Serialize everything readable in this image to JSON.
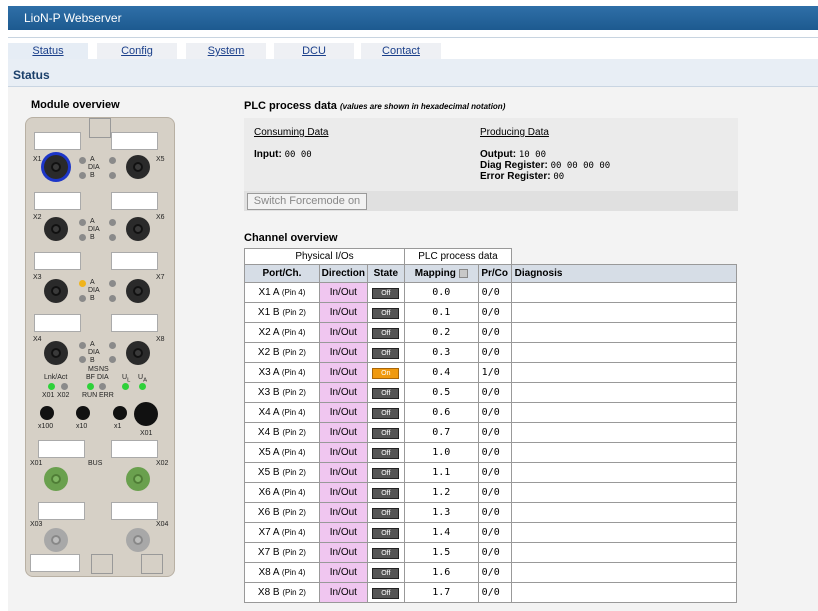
{
  "app": {
    "title": "LioN-P Webserver"
  },
  "tabs": [
    {
      "label": "Status",
      "active": true
    },
    {
      "label": "Config"
    },
    {
      "label": "System"
    },
    {
      "label": "DCU"
    },
    {
      "label": "Contact"
    }
  ],
  "status_label": "Status",
  "module": {
    "title": "Module overview",
    "ports": [
      "X1",
      "X5",
      "X2",
      "X6",
      "X3",
      "X7",
      "X4",
      "X8"
    ],
    "led_labels": {
      "a": "A",
      "dia": "DIA",
      "b": "B"
    },
    "status_labels": {
      "lnk_act": "Lnk/Act",
      "ms": "MS",
      "ns": "NS",
      "bf": "BF",
      "dia": "DIA",
      "ul": "U",
      "ul_sub": "L",
      "ua": "U",
      "ua_sub": "A",
      "x01": "X01",
      "x02": "X02",
      "run": "RUN",
      "err": "ERR"
    },
    "rotary_labels": [
      "x100",
      "x10",
      "x1"
    ],
    "x01_label": "X01",
    "bus_labels": {
      "left": "X01",
      "mid": "BUS",
      "right": "X02"
    },
    "power_labels": {
      "left": "X03",
      "right": "X04"
    }
  },
  "plc": {
    "title": "PLC process data",
    "note": "(values are shown in hexadecimal notation)",
    "consuming_label": "Consuming Data",
    "producing_label": "Producing Data",
    "input_label": "Input",
    "input_value": "00 00",
    "output_label": "Output",
    "output_value": "10 00",
    "diag_label": "Diag Register",
    "diag_value": "00 00 00 00",
    "error_label": "Error Register",
    "error_value": "00"
  },
  "force_button": "Switch Forcemode on",
  "channel": {
    "title": "Channel overview",
    "group_physical": "Physical I/Os",
    "group_plc": "PLC process data",
    "headers": {
      "port": "Port/Ch.",
      "direction": "Direction",
      "state": "State",
      "mapping": "Mapping",
      "prco": "Pr/Co",
      "diagnosis": "Diagnosis"
    },
    "rows": [
      {
        "port": "X1 A",
        "pin": "(Pin 4)",
        "direction": "In/Out",
        "state": "Off",
        "mapping": "0.0",
        "prco": "0/0"
      },
      {
        "port": "X1 B",
        "pin": "(Pin 2)",
        "direction": "In/Out",
        "state": "Off",
        "mapping": "0.1",
        "prco": "0/0"
      },
      {
        "port": "X2 A",
        "pin": "(Pin 4)",
        "direction": "In/Out",
        "state": "Off",
        "mapping": "0.2",
        "prco": "0/0"
      },
      {
        "port": "X2 B",
        "pin": "(Pin 2)",
        "direction": "In/Out",
        "state": "Off",
        "mapping": "0.3",
        "prco": "0/0"
      },
      {
        "port": "X3 A",
        "pin": "(Pin 4)",
        "direction": "In/Out",
        "state": "On",
        "mapping": "0.4",
        "prco": "1/0"
      },
      {
        "port": "X3 B",
        "pin": "(Pin 2)",
        "direction": "In/Out",
        "state": "Off",
        "mapping": "0.5",
        "prco": "0/0"
      },
      {
        "port": "X4 A",
        "pin": "(Pin 4)",
        "direction": "In/Out",
        "state": "Off",
        "mapping": "0.6",
        "prco": "0/0"
      },
      {
        "port": "X4 B",
        "pin": "(Pin 2)",
        "direction": "In/Out",
        "state": "Off",
        "mapping": "0.7",
        "prco": "0/0"
      },
      {
        "port": "X5 A",
        "pin": "(Pin 4)",
        "direction": "In/Out",
        "state": "Off",
        "mapping": "1.0",
        "prco": "0/0"
      },
      {
        "port": "X5 B",
        "pin": "(Pin 2)",
        "direction": "In/Out",
        "state": "Off",
        "mapping": "1.1",
        "prco": "0/0"
      },
      {
        "port": "X6 A",
        "pin": "(Pin 4)",
        "direction": "In/Out",
        "state": "Off",
        "mapping": "1.2",
        "prco": "0/0"
      },
      {
        "port": "X6 B",
        "pin": "(Pin 2)",
        "direction": "In/Out",
        "state": "Off",
        "mapping": "1.3",
        "prco": "0/0"
      },
      {
        "port": "X7 A",
        "pin": "(Pin 4)",
        "direction": "In/Out",
        "state": "Off",
        "mapping": "1.4",
        "prco": "0/0"
      },
      {
        "port": "X7 B",
        "pin": "(Pin 2)",
        "direction": "In/Out",
        "state": "Off",
        "mapping": "1.5",
        "prco": "0/0"
      },
      {
        "port": "X8 A",
        "pin": "(Pin 4)",
        "direction": "In/Out",
        "state": "Off",
        "mapping": "1.6",
        "prco": "0/0"
      },
      {
        "port": "X8 B",
        "pin": "(Pin 2)",
        "direction": "In/Out",
        "state": "Off",
        "mapping": "1.7",
        "prco": "0/0"
      }
    ]
  },
  "colors": {
    "title_bar": "#1d5a90",
    "direction_cell": "#f0c6f0",
    "state_on": "#f09a10",
    "state_off": "#555555",
    "led_green": "#2ed13a",
    "led_yellow": "#f0b41c"
  }
}
